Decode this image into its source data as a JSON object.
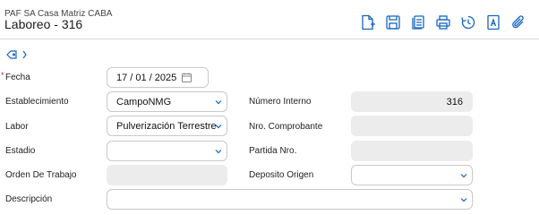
{
  "header": {
    "company": "PAF SA Casa Matriz CABA",
    "title": "Laboreo - 316"
  },
  "toolbar": {
    "icons": [
      "new-document-icon",
      "save-icon",
      "copy-documents-icon",
      "print-icon",
      "refresh-icon",
      "document-a-icon",
      "attachment-icon"
    ],
    "accent_color": "#1565c0"
  },
  "form": {
    "required_marker": "*",
    "fecha": {
      "label": "Fecha",
      "value": "17 / 01 / 2025"
    },
    "establecimiento": {
      "label": "Establecimiento",
      "value": "CampoNMG"
    },
    "labor": {
      "label": "Labor",
      "value": "Pulverización Terrestre"
    },
    "estadio": {
      "label": "Estadio",
      "value": ""
    },
    "orden_de_trabajo": {
      "label": "Orden De Trabajo",
      "value": ""
    },
    "descripcion": {
      "label": "Descripción",
      "value": ""
    },
    "numero_interno": {
      "label": "Número Interno",
      "value": "316"
    },
    "nro_comprobante": {
      "label": "Nro. Comprobante",
      "value": ""
    },
    "partida_nro": {
      "label": "Partida Nro.",
      "value": ""
    },
    "deposito_origen": {
      "label": "Deposito Origen",
      "value": ""
    }
  }
}
